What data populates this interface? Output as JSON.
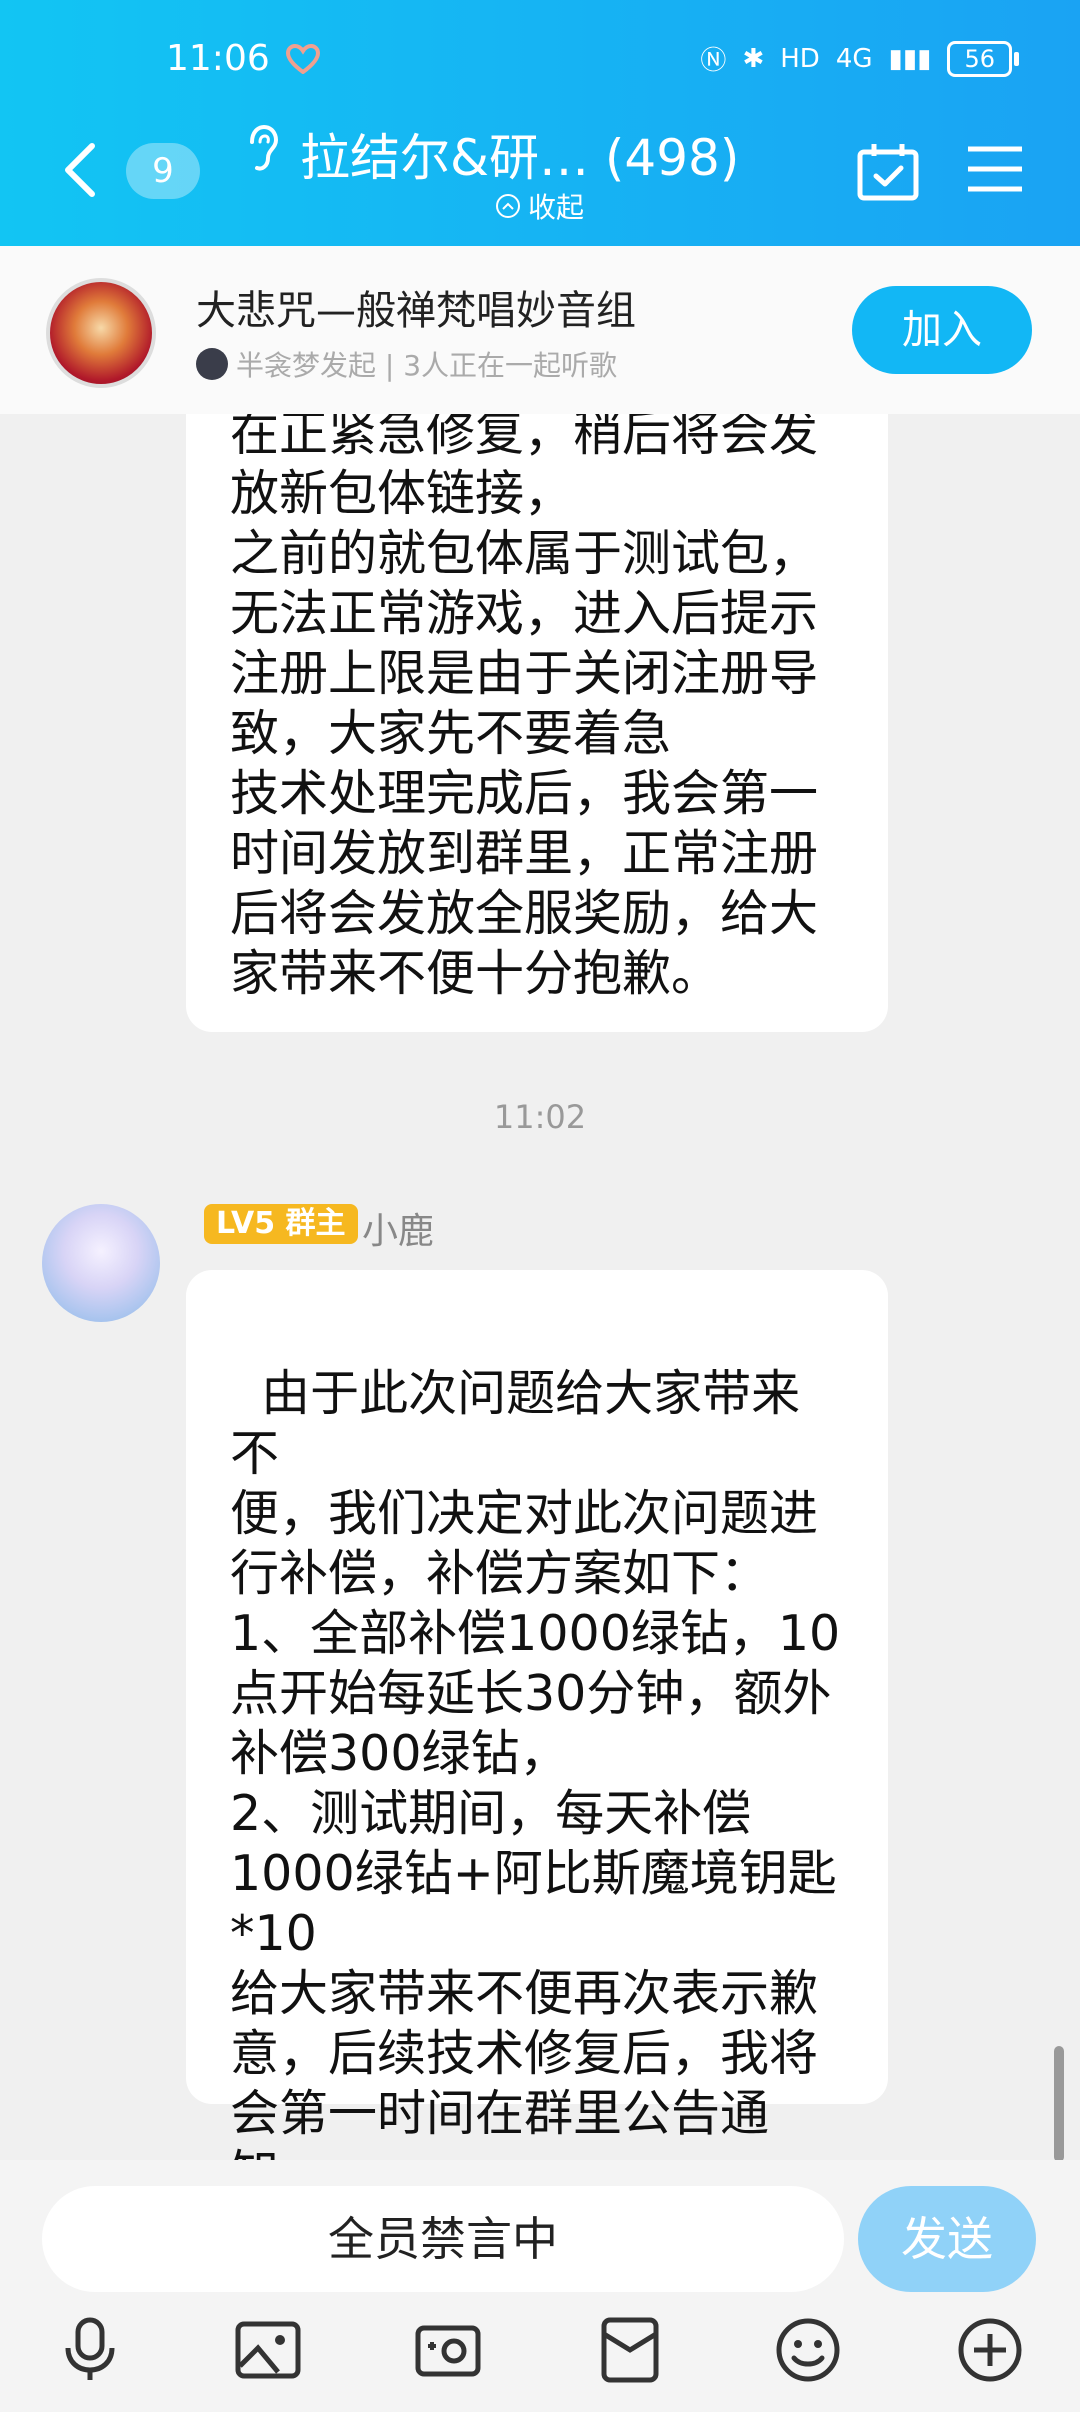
{
  "status_bar": {
    "time": "11:06",
    "network": "4G",
    "battery": "56"
  },
  "header": {
    "unread_count": "9",
    "group_title": "拉结尔&研…  (498)",
    "collapse_label": "收起"
  },
  "banner": {
    "title": "大悲咒—般禅梵唱妙音组",
    "subtitle": "半衾梦发起 | 3人正在一起听歌",
    "join_label": "加入"
  },
  "messages": {
    "first_text": "在正紧急修复，稍后将会发\n放新包体链接，\n之前的就包体属于测试包，\n无法正常游戏，进入后提示\n注册上限是由于关闭注册导\n致，大家先不要着急\n技术处理完成后，我会第一\n时间发放到群里，正常注册\n后将会发放全服奖励，给大\n家带来不便十分抱歉。",
    "timestamp": "11:02",
    "sender_level": "LV5 群主",
    "sender_name": "小鹿",
    "second_text": "由于此次问题给大家带来不\n便，我们决定对此次问题进\n行补偿，补偿方案如下：\n1、全部补偿1000绿钻，10\n点开始每延长30分钟，额外\n补偿300绿钻，\n2、测试期间，每天补偿\n1000绿钻+阿比斯魔境钥匙\n*10\n给大家带来不便再次表示歉\n意，后续技术修复后，我将\n会第一时间在群里公告通\n知。"
  },
  "input": {
    "muted_label": "全员禁言中",
    "send_label": "发送"
  },
  "toolbar": {
    "icons": [
      "microphone-icon",
      "image-icon",
      "camera-icon",
      "red-packet-icon",
      "emoji-icon",
      "plus-icon"
    ]
  },
  "colors": {
    "header_start": "#12c5f3",
    "header_end": "#1aa3f3",
    "join_button": "#12b7f5",
    "send_button": "#90d2f8",
    "level_badge": "#f6b820"
  }
}
